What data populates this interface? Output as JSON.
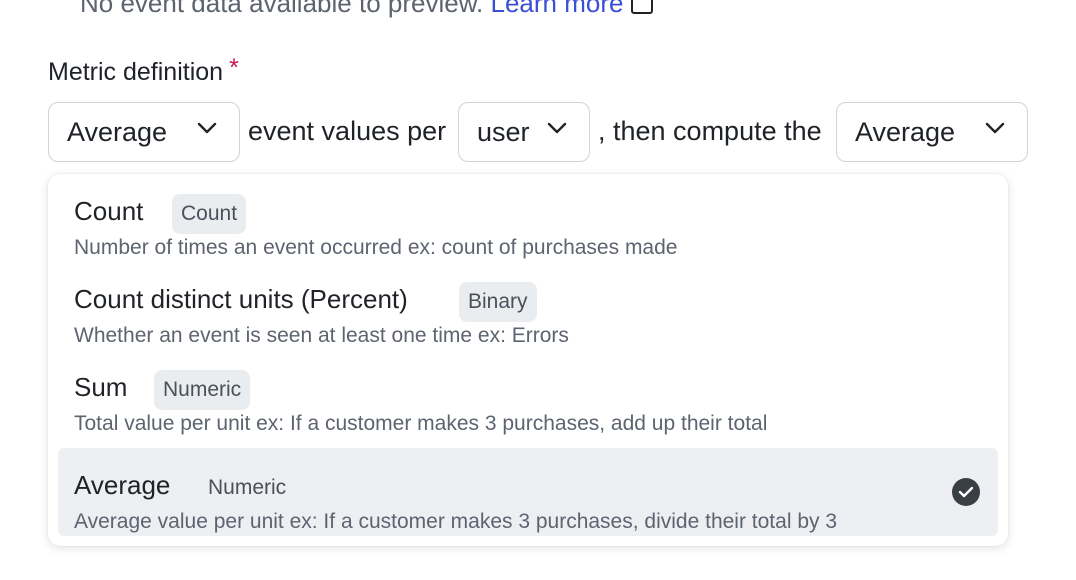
{
  "top_note": {
    "text": "No event data available to preview.",
    "link": "Learn more",
    "icon": "external-link-icon"
  },
  "metric": {
    "label": "Metric definition",
    "required_mark": "*",
    "aggregation_select": "Average",
    "text_1": "event values per",
    "unit_select": "user",
    "text_2": ", then compute the",
    "compute_select": "Average"
  },
  "dropdown": {
    "options": [
      {
        "title": "Count",
        "badge": "Count",
        "description": "Number of times an event occurred ex: count of purchases made",
        "selected": false
      },
      {
        "title": "Count distinct units (Percent)",
        "badge": "Binary",
        "description": "Whether an event is seen at least one time ex: Errors",
        "selected": false
      },
      {
        "title": "Sum",
        "badge": "Numeric",
        "description": "Total value per unit ex: If a customer makes 3 purchases, add up their total",
        "selected": false
      },
      {
        "title": "Average",
        "badge": "Numeric",
        "description": "Average value per unit ex: If a customer makes 3 purchases, divide their total by 3",
        "selected": true
      }
    ]
  },
  "colors": {
    "required": "#c2185b",
    "link": "#3b4fd6",
    "selected_bg": "#edeff2"
  }
}
